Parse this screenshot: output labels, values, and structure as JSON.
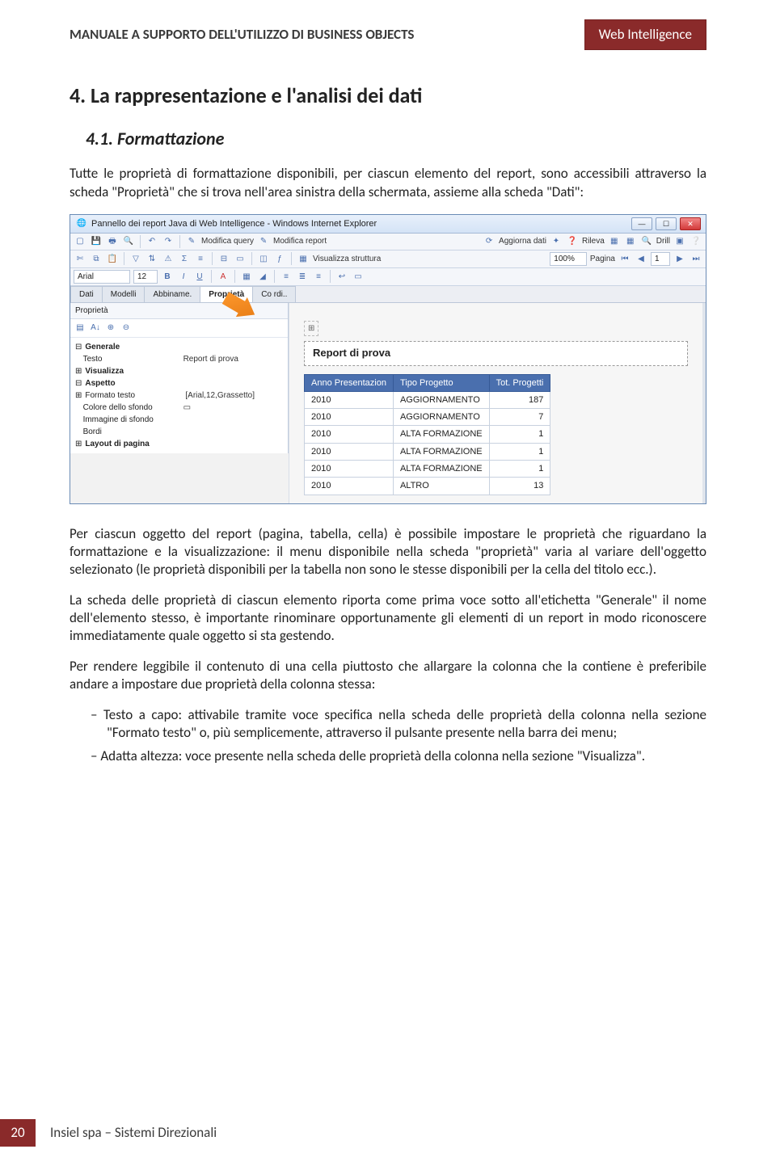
{
  "header": {
    "title": "MANUALE A SUPPORTO DELL'UTILIZZO DI BUSINESS OBJECTS",
    "badge": "Web Intelligence"
  },
  "section": "4. La rappresentazione e l'analisi dei dati",
  "subsection": "4.1. Formattazione",
  "para1": "Tutte le proprietà di formattazione disponibili, per ciascun elemento del report, sono accessibili attraverso la scheda \"Proprietà\" che si trova nell'area sinistra della schermata, assieme alla scheda \"Dati\":",
  "screenshot": {
    "window_title": "Pannello dei report Java di Web Intelligence - Windows Internet Explorer",
    "btn_modifica_query": "Modifica query",
    "btn_modifica_report": "Modifica report",
    "btn_aggiorna": "Aggiorna dati",
    "btn_rileva": "Rileva",
    "btn_drill": "Drill",
    "btn_visualizza_struttura": "Visualizza struttura",
    "zoom": "100%",
    "pagina": "Pagina",
    "pagina_val": "1",
    "font_name": "Arial",
    "font_size": "12",
    "tabs": {
      "t0": "Dati",
      "t1": "Modelli",
      "t2": "Abbiname.",
      "t3": "Proprietà",
      "t4": "Co     rdi.."
    },
    "prop_title": "Proprietà",
    "tree": {
      "generale": "Generale",
      "testo_lbl": "Testo",
      "testo_val": "Report di prova",
      "visualizza": "Visualizza",
      "aspetto": "Aspetto",
      "formato_testo_lbl": "Formato testo",
      "formato_testo_val": "[Arial,12,Grassetto]",
      "colore_sfondo": "Colore dello sfondo",
      "immagine_sfondo": "Immagine di sfondo",
      "bordi": "Bordi",
      "layout": "Layout di pagina"
    },
    "report_title": "Report di prova",
    "cols": {
      "c0": "Anno Presentazion",
      "c1": "Tipo Progetto",
      "c2": "Tot. Progetti"
    },
    "rows": [
      {
        "y": "2010",
        "t": "AGGIORNAMENTO",
        "n": "187"
      },
      {
        "y": "2010",
        "t": "AGGIORNAMENTO",
        "n": "7"
      },
      {
        "y": "2010",
        "t": "ALTA FORMAZIONE",
        "n": "1"
      },
      {
        "y": "2010",
        "t": "ALTA FORMAZIONE",
        "n": "1"
      },
      {
        "y": "2010",
        "t": "ALTA FORMAZIONE",
        "n": "1"
      },
      {
        "y": "2010",
        "t": "ALTRO",
        "n": "13"
      }
    ]
  },
  "para2": "Per ciascun oggetto del report (pagina, tabella, cella) è possibile impostare le proprietà che riguardano la formattazione e la visualizzazione: il menu disponibile nella scheda \"proprietà\" varia al variare dell'oggetto selezionato (le proprietà disponibili per la tabella non sono le stesse disponibili per la cella del titolo ecc.).",
  "para3": "La scheda delle proprietà di ciascun elemento riporta come prima voce sotto all'etichetta \"Generale\" il nome dell'elemento stesso, è importante rinominare opportunamente gli elementi di un report in modo riconoscere immediatamente quale oggetto si sta gestendo.",
  "para4": "Per rendere leggibile il contenuto di una cella piuttosto che allargare la colonna che la contiene è preferibile andare a impostare due proprietà della colonna stessa:",
  "bullets": {
    "b0": "Testo a capo: attivabile tramite voce specifica nella scheda delle proprietà della colonna  nella sezione \"Formato testo\" o, più semplicemente, attraverso il pulsante presente nella barra dei menu;",
    "b1": "Adatta altezza: voce presente nella scheda delle proprietà della colonna nella sezione \"Visualizza\"."
  },
  "footer": {
    "page": "20",
    "text": "Insiel spa – Sistemi Direzionali"
  }
}
